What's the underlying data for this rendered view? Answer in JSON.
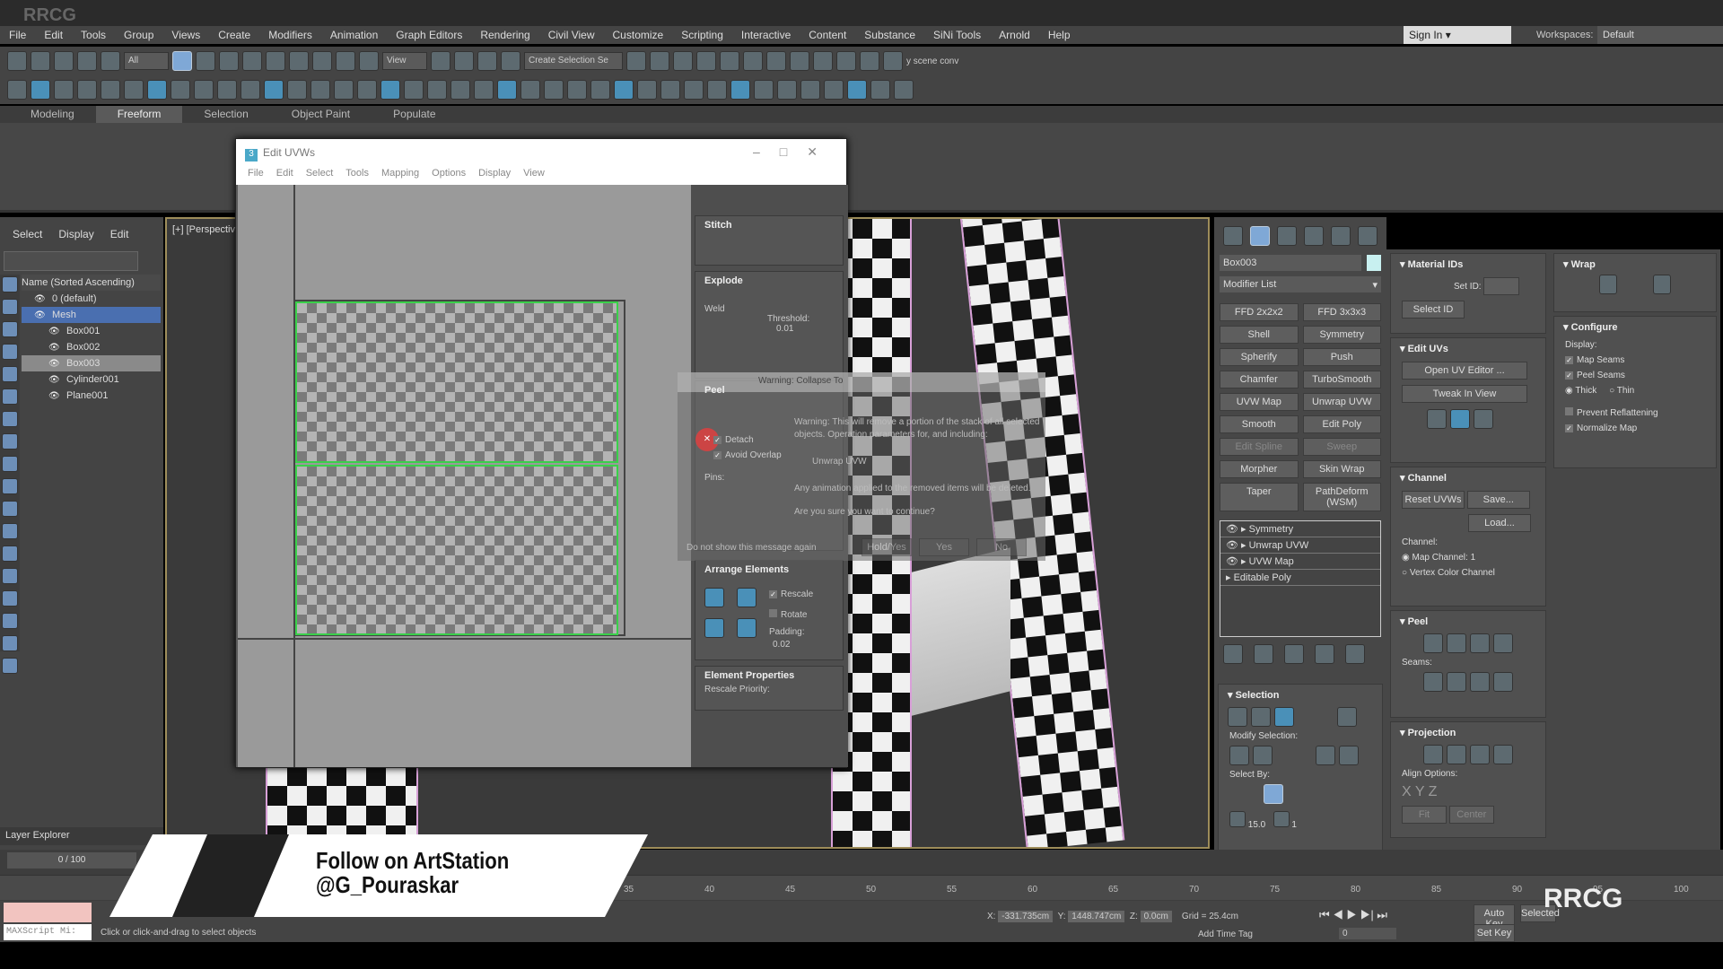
{
  "watermark": "RRCG",
  "menu": [
    "File",
    "Edit",
    "Tools",
    "Group",
    "Views",
    "Create",
    "Modifiers",
    "Animation",
    "Graph Editors",
    "Rendering",
    "Civil View",
    "Customize",
    "Scripting",
    "Interactive",
    "Content",
    "Substance",
    "SiNi Tools",
    "Arnold",
    "Help"
  ],
  "signin": "Sign In",
  "workspace": {
    "label": "Workspaces:",
    "value": "Default"
  },
  "toolbar1": {
    "filter": "All",
    "view": "View",
    "selset": "Create Selection Se",
    "extra": "y scene conv",
    "icons": [
      "undo",
      "redo",
      "link",
      "unlink",
      "bind-spacewarp",
      "select",
      "select-by-name",
      "rect-select",
      "window-crossing",
      "move",
      "rotate",
      "scale",
      "place",
      "snap",
      "angle-snap",
      "percent-snap",
      "spinner-snap",
      "edit-named-sel",
      "mirror",
      "align",
      "layer-manager",
      "toggle-ribbon",
      "scene-explorer",
      "curve-editor",
      "schematic",
      "material-editor",
      "render-setup",
      "rendered-frame",
      "render",
      "render-iterative"
    ]
  },
  "toolbar2": {
    "icons": [
      "teapot",
      "sphere-gen",
      "box-gen",
      "light",
      "camera",
      "helper",
      "cylinder",
      "egg",
      "torus",
      "teapot2",
      "cone",
      "sun",
      "capsule",
      "pattern",
      "paint",
      "tripod",
      "gear",
      "plant",
      "sphere",
      "particles",
      "render-view",
      "bottle",
      "chart",
      "help",
      "bulb",
      "star",
      "robot",
      "tree",
      "list",
      "pipe",
      "cylinder2",
      "ring",
      "monitor",
      "grid",
      "box2",
      "cluster",
      "frame",
      "eye-target",
      "lamp"
    ]
  },
  "ribbon_tabs": [
    "Modeling",
    "Freeform",
    "Selection",
    "Object Paint",
    "Populate"
  ],
  "left": {
    "menu": [
      "Select",
      "Display",
      "Edit"
    ],
    "header": "Name (Sorted Ascending)",
    "items": [
      "0 (default)",
      "Mesh",
      "Box001",
      "Box002",
      "Box003",
      "Cylinder001",
      "Plane001"
    ],
    "layer_explorer": "Layer Explorer"
  },
  "viewport": {
    "label": "[+] [Perspective"
  },
  "uv": {
    "title": "Edit UVWs",
    "menu": [
      "File",
      "Edit",
      "Select",
      "Tools",
      "Mapping",
      "Options",
      "Display",
      "View"
    ],
    "rollouts": {
      "stitch": "Stitch",
      "explode": "Explode",
      "weld": "Weld",
      "threshold": "Threshold:",
      "threshold_val": "0.01",
      "peel": "Peel",
      "detach": "Detach",
      "avoid": "Avoid Overlap",
      "pins": "Pins:",
      "arrange": "Arrange Elements",
      "rescale": "Rescale",
      "rotate": "Rotate",
      "padding": "Padding:",
      "padding_val": "0.02",
      "elem_props": "Element Properties",
      "rescale_priority": "Rescale Priority:"
    }
  },
  "warning": {
    "title": "Warning: Collapse To",
    "line1": "Warning: This will remove a portion of the stack of all selected",
    "line2": "objects. Operation parameters for, and including:",
    "line3": "Unwrap UVW",
    "line4": "Any animation applied to the removed items will be deleted.",
    "line5": "Are you sure you want to continue?",
    "dontshow": "Do not show this message again",
    "buttons": [
      "Hold/Yes",
      "Yes",
      "No"
    ]
  },
  "cmd": {
    "object": "Box003",
    "object_color": "#c8f0f0",
    "modlist": "Modifier List",
    "modifiers": [
      "FFD 2x2x2",
      "FFD 3x3x3",
      "Shell",
      "Symmetry",
      "Spherify",
      "Push",
      "Chamfer",
      "TurboSmooth",
      "UVW Map",
      "Unwrap UVW",
      "Smooth",
      "Edit Poly",
      "Edit Spline",
      "Sweep",
      "Morpher",
      "Skin Wrap",
      "Taper",
      "PathDeform (WSM)"
    ],
    "stack": [
      "Symmetry",
      "Unwrap UVW",
      "UVW Map",
      "Editable Poly"
    ],
    "selection": {
      "title": "Selection",
      "modify": "Modify Selection:",
      "select_by": "Select By:",
      "angle": "15.0",
      "count": "1"
    }
  },
  "col2": {
    "matids": "Material IDs",
    "setid": "Set ID:",
    "selectid": "Select ID",
    "edituvs": "Edit UVs",
    "open": "Open UV Editor ...",
    "tweak": "Tweak In View",
    "channel": "Channel",
    "reset": "Reset UVWs",
    "save": "Save...",
    "load": "Load...",
    "channel_lbl": "Channel:",
    "mapch": "Map Channel:",
    "mapch_val": "1",
    "vcc": "Vertex Color Channel",
    "peel": "Peel",
    "seams": "Seams:",
    "projection": "Projection",
    "align": "Align Options:",
    "fit": "Fit",
    "center": "Center"
  },
  "col3": {
    "wrap": "Wrap",
    "configure": "Configure",
    "display": "Display:",
    "map_seams": "Map Seams",
    "peel_seams": "Peel Seams",
    "thick": "Thick",
    "thin": "Thin",
    "prevent": "Prevent Reflattening",
    "normalize": "Normalize Map"
  },
  "timeline": {
    "frames": "0 / 100",
    "ticks": [
      "35",
      "40",
      "45",
      "50",
      "55",
      "60",
      "65",
      "70",
      "75",
      "80",
      "85",
      "90",
      "95",
      "100"
    ]
  },
  "status": {
    "x": "-331.735cm",
    "y": "1448.747cm",
    "z": "0.0cm",
    "grid": "Grid = 25.4cm",
    "addtag": "Add Time Tag",
    "frame": "0",
    "autokey": "Auto Key",
    "setkey": "Set Key",
    "selected": "Selected",
    "msg": "Click or click-and-drag to select objects",
    "maxscript": "MAXScript Mi:"
  },
  "banner": {
    "l1": "Follow on ArtStation",
    "l2": "@G_Pouraskar"
  },
  "logo": "RRCG"
}
